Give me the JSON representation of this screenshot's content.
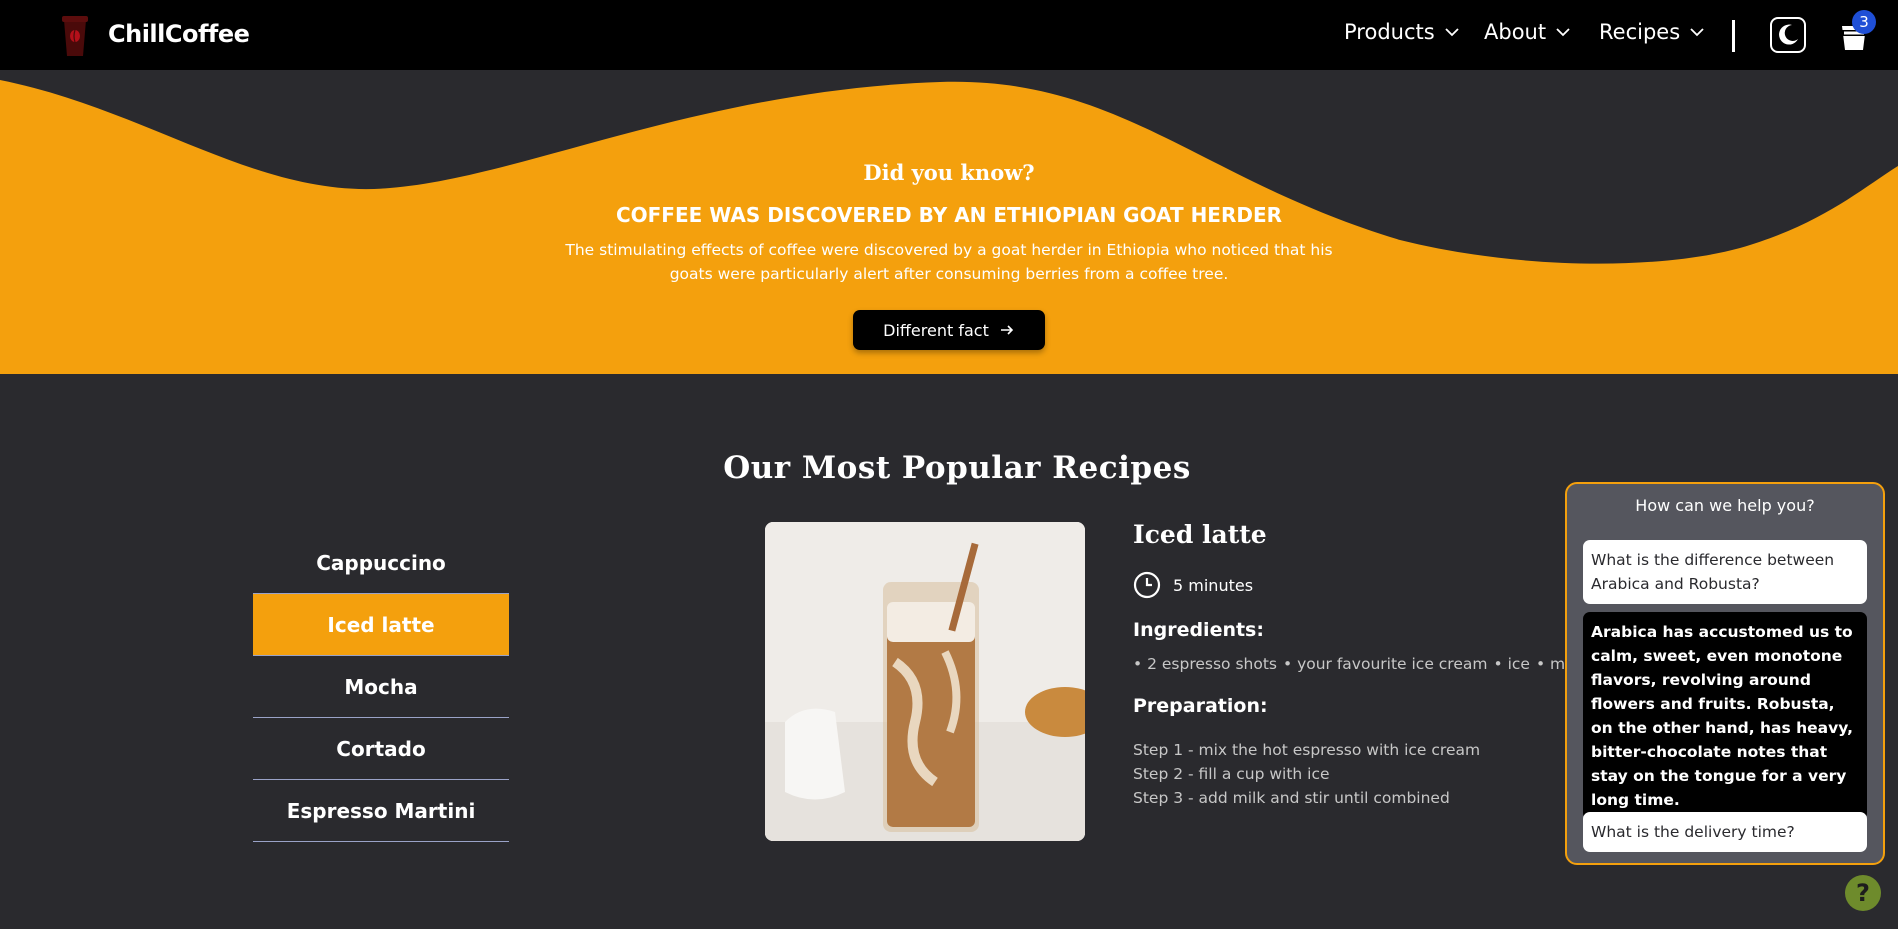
{
  "colors": {
    "accent": "#f4a00d",
    "nav_bg": "#000000",
    "page_bg": "#2a2a2e",
    "badge": "#1f4fd6",
    "widget_bg": "#55565e",
    "fab": "#6e8b2c"
  },
  "header": {
    "brand": "ChillCoffee",
    "logo_icon": "coffee-cup-logo",
    "nav": [
      {
        "label": "Products",
        "icon": "chevron-down-icon"
      },
      {
        "label": "About",
        "icon": "chevron-down-icon"
      },
      {
        "label": "Recipes",
        "icon": "chevron-down-icon"
      }
    ],
    "theme_icon": "moon-icon",
    "cart_icon": "cart-icon",
    "cart_count": "3"
  },
  "fact": {
    "kicker": "Did you know?",
    "title": "COFFEE WAS DISCOVERED BY AN ETHIOPIAN GOAT HERDER",
    "text": "The stimulating effects of coffee were discovered by a goat herder in Ethiopia who noticed that his goats were particularly alert after consuming berries from a coffee tree.",
    "button_label": "Different fact",
    "button_icon": "arrow-right-icon"
  },
  "recipes": {
    "section_title": "Our Most Popular Recipes",
    "tabs": [
      "Cappuccino",
      "Iced latte",
      "Mocha",
      "Cortado",
      "Espresso Martini"
    ],
    "active_tab": "Iced latte",
    "selected": {
      "name": "Iced latte",
      "time": "5 minutes",
      "time_icon": "clock-icon",
      "ingredients_heading": "Ingredients:",
      "ingredients": [
        "2 espresso shots",
        "your favourite ice cream",
        "ice",
        "milk"
      ],
      "preparation_heading": "Preparation:",
      "steps": [
        "Step 1 - mix the hot espresso with ice cream",
        "Step 2 - fill a cup with ice",
        "Step 3 - add milk and stir until combined"
      ]
    }
  },
  "help_widget": {
    "title": "How can we help you?",
    "messages": [
      {
        "role": "question",
        "text": "What is the difference between Arabica and Robusta?"
      },
      {
        "role": "answer",
        "text": "Arabica has accustomed us to calm, sweet, even monotone flavors, revolving around flowers and fruits. Robusta, on the other hand, has heavy, bitter-chocolate notes that stay on the tongue for a very long time."
      },
      {
        "role": "question",
        "text": "What is the delivery time?"
      }
    ],
    "fab_label": "?"
  }
}
